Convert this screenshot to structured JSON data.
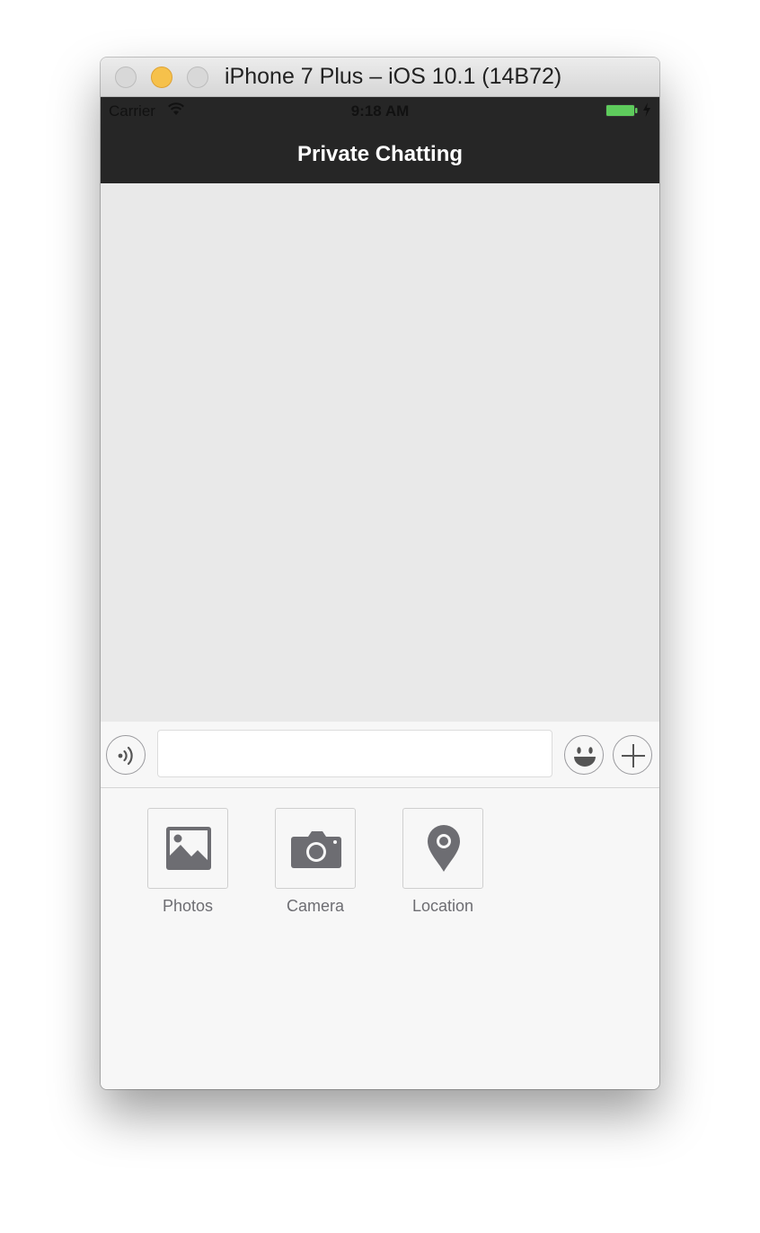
{
  "window": {
    "title": "iPhone 7 Plus – iOS 10.1 (14B72)"
  },
  "status_bar": {
    "carrier": "Carrier",
    "time": "9:18 AM",
    "icons": [
      "wifi-icon",
      "battery-icon",
      "charging-bolt-icon"
    ],
    "battery_color": "#5ecb5c"
  },
  "nav_bar": {
    "title": "Private Chatting",
    "background": "#262626"
  },
  "input_bar": {
    "text_value": "",
    "placeholder": "",
    "icons": [
      "voice-icon",
      "emoji-icon",
      "plus-icon"
    ]
  },
  "more_panel": {
    "items": [
      {
        "label": "Photos",
        "icon": "photo-icon"
      },
      {
        "label": "Camera",
        "icon": "camera-icon"
      },
      {
        "label": "Location",
        "icon": "location-pin-icon"
      }
    ],
    "icon_color": "#6d6d72"
  }
}
